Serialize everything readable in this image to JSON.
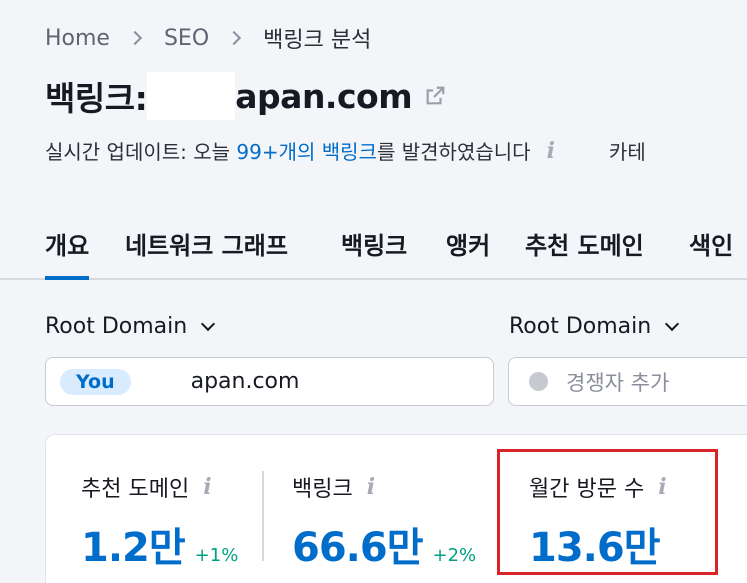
{
  "breadcrumb": {
    "items": [
      "Home",
      "SEO",
      "백링크 분석"
    ]
  },
  "title": {
    "prefix": "백링크:",
    "domain": "apan.com"
  },
  "update": {
    "prefix": "실시간 업데이트: 오늘 ",
    "link": "99+개의 백링크",
    "suffix": "를 발견하였습니다",
    "category": "카테"
  },
  "tabs": [
    "개요",
    "네트워크 그래프",
    "백링크",
    "앵커",
    "추천 도메인",
    "색인"
  ],
  "filters": {
    "left_dropdown": "Root Domain",
    "right_dropdown": "Root Domain",
    "you_badge": "You",
    "you_domain": "apan.com",
    "competitor_placeholder": "경쟁자 추가"
  },
  "metrics": [
    {
      "label": "추천 도메인",
      "value": "1.2만",
      "delta": "+1%"
    },
    {
      "label": "백링크",
      "value": "66.6만",
      "delta": "+2%"
    },
    {
      "label": "월간 방문 수",
      "value": "13.6만",
      "delta": ""
    }
  ],
  "colors": {
    "accent": "#006dca",
    "positive": "#009f81",
    "highlight": "#d9252a",
    "background": "#f4f5f9"
  },
  "icons": {
    "info": "i",
    "external_link": "external-link-icon"
  }
}
